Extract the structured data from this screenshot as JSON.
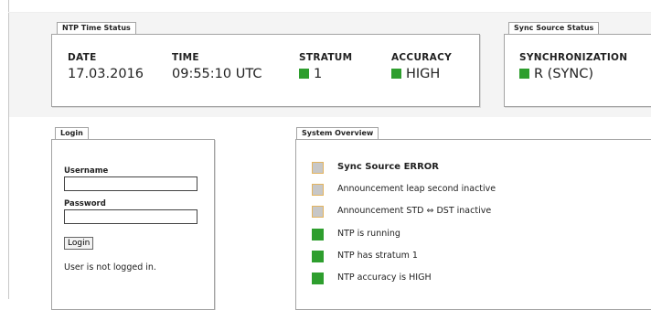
{
  "ntp_status": {
    "title": "NTP Time Status",
    "date_label": "DATE",
    "date_value": "17.03.2016",
    "time_label": "TIME",
    "time_value": "09:55:10 UTC",
    "stratum_label": "STRATUM",
    "stratum_value": "1",
    "stratum_color": "#2e9e2e",
    "accuracy_label": "ACCURACY",
    "accuracy_value": "HIGH",
    "accuracy_color": "#2e9e2e"
  },
  "sync_status": {
    "title": "Sync Source Status",
    "sync_label": "SYNCHRONIZATION",
    "sync_value": "R (SYNC)",
    "sync_color": "#2e9e2e"
  },
  "login": {
    "title": "Login",
    "username_label": "Username",
    "username_value": "",
    "password_label": "Password",
    "password_value": "",
    "button_label": "Login",
    "status_text": "User is not logged in."
  },
  "overview": {
    "title": "System Overview",
    "items": [
      {
        "text": "Sync Source ERROR",
        "state": "grey",
        "bold": true
      },
      {
        "text": "Announcement leap second inactive",
        "state": "grey",
        "bold": false
      },
      {
        "text": "Announcement STD ⇔ DST inactive",
        "state": "grey",
        "bold": false
      },
      {
        "text": "NTP is running",
        "state": "green",
        "bold": false
      },
      {
        "text": "NTP has stratum 1",
        "state": "green",
        "bold": false
      },
      {
        "text": "NTP accuracy is HIGH",
        "state": "green",
        "bold": false
      }
    ]
  }
}
